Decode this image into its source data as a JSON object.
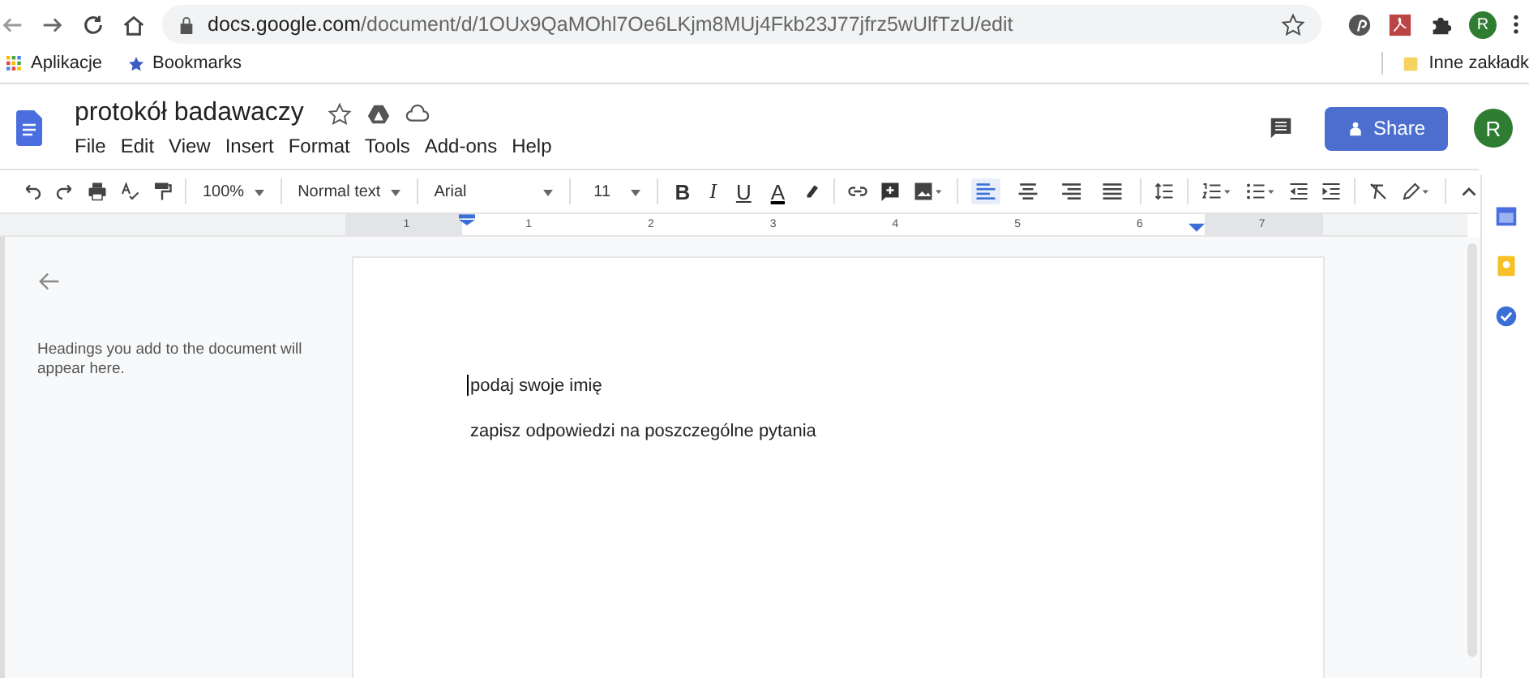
{
  "browser": {
    "url_host": "docs.google.com",
    "url_path": "/document/d/1OUx9QaMOhl7Oe6LKjm8MUj4Fkb23J77jfrz5wUlfTzU/edit",
    "profile": "R",
    "bookmarks": [
      {
        "label": "Aplikacje",
        "kind": "apps"
      },
      {
        "label": "Bookmarks",
        "kind": "star"
      }
    ],
    "other_bookmarks": "Inne zakładk"
  },
  "document": {
    "title": "protokół badawaczy",
    "menu": [
      "File",
      "Edit",
      "View",
      "Insert",
      "Format",
      "Tools",
      "Add-ons",
      "Help"
    ],
    "share": "Share",
    "account": "R"
  },
  "toolbar": {
    "zoom": "100%",
    "style": "Normal text",
    "font": "Arial",
    "size": "11",
    "format": [
      "B",
      "I",
      "U",
      "A"
    ],
    "align": [
      {
        "selected": true
      },
      {
        "selected": false
      },
      {
        "selected": false
      },
      {
        "selected": false
      }
    ]
  },
  "ruler": {
    "marks": [
      "1",
      "1",
      "2",
      "3",
      "4",
      "5",
      "6",
      "7"
    ]
  },
  "outline": {
    "hint": "Headings you add to the document will appear here."
  },
  "page": {
    "paragraphs": [
      "podaj swoje imię",
      "zapisz odpowiedzi na poszczególne pytania"
    ]
  }
}
